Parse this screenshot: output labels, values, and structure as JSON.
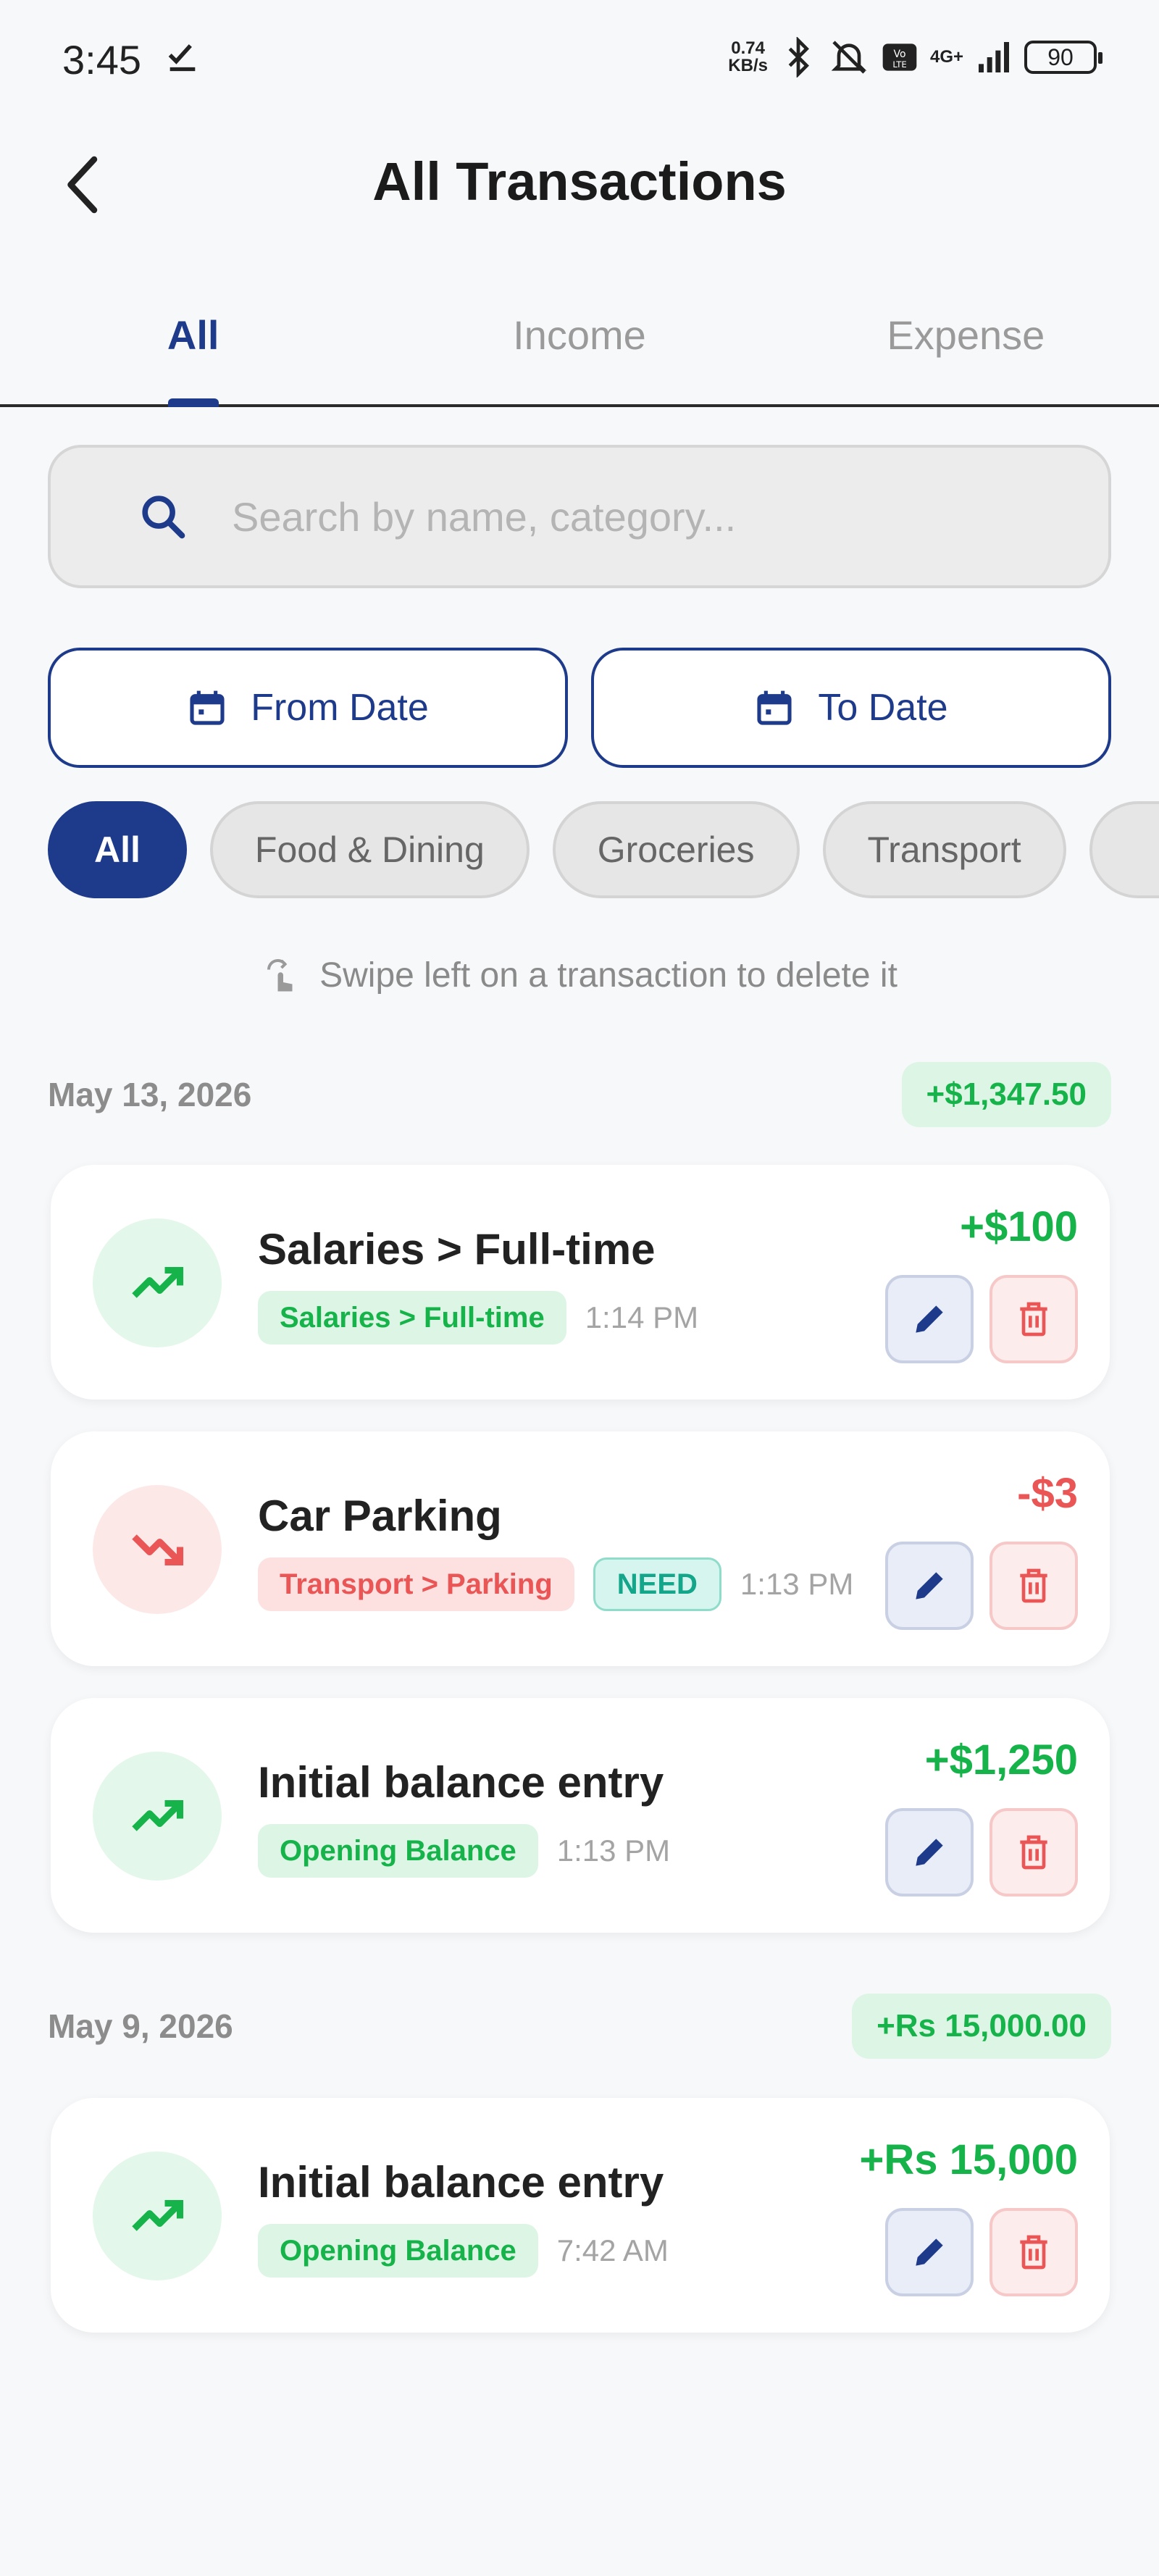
{
  "status_bar": {
    "time": "3:45",
    "net_speed_value": "0.74",
    "net_speed_unit": "KB/s",
    "network": "4G+",
    "battery": "90"
  },
  "header": {
    "title": "All Transactions"
  },
  "tabs": [
    {
      "label": "All",
      "active": true
    },
    {
      "label": "Income",
      "active": false
    },
    {
      "label": "Expense",
      "active": false
    }
  ],
  "search": {
    "placeholder": "Search by name, category...",
    "value": ""
  },
  "date_filters": {
    "from_label": "From Date",
    "to_label": "To Date"
  },
  "categories": [
    {
      "label": "All",
      "active": true
    },
    {
      "label": "Food & Dining",
      "active": false
    },
    {
      "label": "Groceries",
      "active": false
    },
    {
      "label": "Transport",
      "active": false
    }
  ],
  "hint": "Swipe left on a transaction to delete it",
  "groups": [
    {
      "date": "May 13, 2026",
      "total": "+$1,347.50",
      "transactions": [
        {
          "name": "Salaries > Full-time",
          "category": "Salaries > Full-time",
          "tag": "",
          "time": "1:14 PM",
          "amount": "+$100",
          "type": "income"
        },
        {
          "name": "Car Parking",
          "category": "Transport > Parking",
          "tag": "NEED",
          "time": "1:13 PM",
          "amount": "-$3",
          "type": "expense"
        },
        {
          "name": "Initial balance entry",
          "category": "Opening Balance",
          "tag": "",
          "time": "1:13 PM",
          "amount": "+$1,250",
          "type": "income"
        }
      ]
    },
    {
      "date": "May 9, 2026",
      "total": "+Rs 15,000.00",
      "transactions": [
        {
          "name": "Initial balance entry",
          "category": "Opening Balance",
          "tag": "",
          "time": "7:42 AM",
          "amount": "+Rs 15,000",
          "type": "income"
        }
      ]
    }
  ],
  "colors": {
    "primary": "#1e3a8a",
    "income": "#16b34a",
    "expense": "#ea5555",
    "background": "#f7f8fa"
  }
}
